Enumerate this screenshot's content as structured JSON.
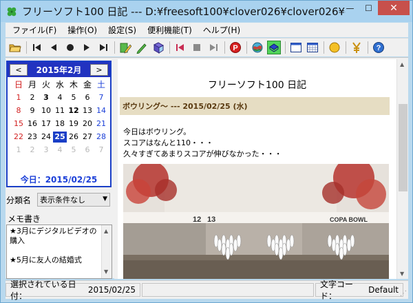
{
  "window": {
    "title": "フリーソフト100 日記  --- D:¥freesoft100¥clover026¥clover026¥cl...",
    "minimize": "—",
    "maximize": "☐",
    "close": "✕"
  },
  "menu": [
    {
      "label": "ファイル(F)"
    },
    {
      "label": "操作(O)"
    },
    {
      "label": "設定(S)"
    },
    {
      "label": "便利機能(T)"
    },
    {
      "label": "ヘルプ(H)"
    }
  ],
  "toolbar_icons": [
    "open-folder-icon",
    "first-icon",
    "prev-icon",
    "record-icon",
    "play-icon",
    "last-icon",
    "edit-pencil-icon",
    "pen-icon",
    "book-icon",
    "back-red-icon",
    "stop-icon",
    "forward-gray-icon",
    "parking-icon",
    "globe-icon",
    "highlight-icon",
    "window-icon",
    "calendar-icon",
    "sun-icon",
    "yen-icon",
    "help-icon"
  ],
  "calendar": {
    "prev": "<",
    "next": ">",
    "month_title": "2015年2月",
    "weekdays": [
      "日",
      "月",
      "火",
      "水",
      "木",
      "金",
      "土"
    ],
    "rows": [
      [
        "1",
        "2",
        "3",
        "4",
        "5",
        "6",
        "7"
      ],
      [
        "8",
        "9",
        "10",
        "11",
        "12",
        "13",
        "14"
      ],
      [
        "15",
        "16",
        "17",
        "18",
        "19",
        "20",
        "21"
      ],
      [
        "22",
        "23",
        "24",
        "25",
        "26",
        "27",
        "28"
      ],
      [
        "1",
        "2",
        "3",
        "4",
        "5",
        "6",
        "7"
      ]
    ],
    "bold_days": [
      "3",
      "12"
    ],
    "selected_day": "25",
    "today_text": "今日：2015/02/25"
  },
  "filter": {
    "label": "分類名",
    "value": "表示条件なし"
  },
  "memo": {
    "label": "メモ書き",
    "lines": [
      "★3月にデジタルビデオの",
      "購入",
      "",
      "★5月に友人の結婚式"
    ]
  },
  "document": {
    "title": "フリーソフト100 日記",
    "entry_header": "ボウリング～ --- 2015/02/25 (水)",
    "body": [
      "今日はボウリング。",
      "スコアはなんと110・・・",
      "久々すぎてあまりスコアが伸びなかった・・・"
    ],
    "photo_lane_numbers": [
      "12",
      "13"
    ],
    "photo_sign": "COPA BOWL"
  },
  "status": {
    "selected_label": "選択されている日付：",
    "selected_value": "2015/02/25",
    "charset_label": "文字コード：",
    "charset_value": "Default"
  },
  "colors": {
    "calendar_header": "#2233c0",
    "sunday": "#d21f1f",
    "saturday": "#1b3fd8",
    "entry_header_bg": "#e6ddc3"
  }
}
